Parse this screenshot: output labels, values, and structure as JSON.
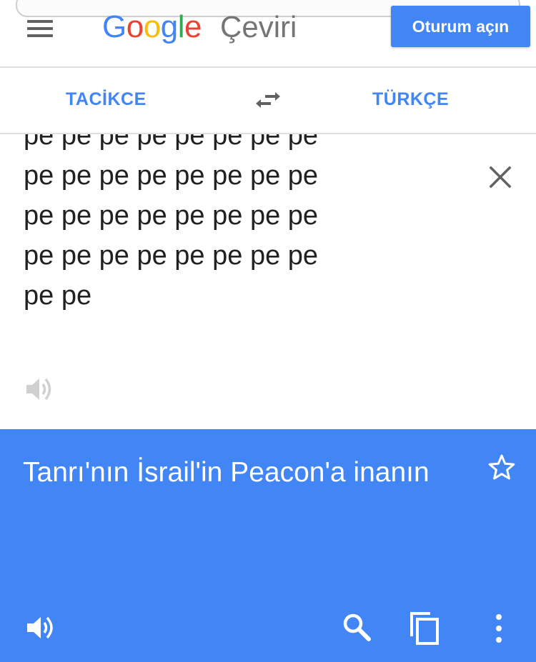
{
  "header": {
    "logo_letters": [
      {
        "char": "G",
        "color": "#4285f4"
      },
      {
        "char": "o",
        "color": "#ea4335"
      },
      {
        "char": "o",
        "color": "#fbbc05"
      },
      {
        "char": "g",
        "color": "#4285f4"
      },
      {
        "char": "l",
        "color": "#34a853"
      },
      {
        "char": "e",
        "color": "#ea4335"
      }
    ],
    "product_name": "Çeviri",
    "signin_label": "Oturum açın",
    "icons": {
      "menu": "menu-icon"
    }
  },
  "language_bar": {
    "source_language": "TACİKCE",
    "target_language": "TÜRKÇE",
    "swap_icon": "swap-arrows-icon"
  },
  "source": {
    "text": "pe pe pe pe pe pe pe pe\npe pe pe pe pe pe pe pe\npe pe pe pe pe pe pe pe\npe pe pe pe pe pe pe pe\npe pe",
    "icons": {
      "clear": "close-icon",
      "speak": "speaker-icon"
    }
  },
  "result": {
    "text": "Tanrı'nın İsrail'in Peacon'a inanın",
    "icons": {
      "star": "star-icon",
      "speak": "speaker-icon",
      "search": "search-icon",
      "copy": "copy-icon",
      "more": "more-vert-icon"
    }
  },
  "colors": {
    "accent": "#4285f4",
    "result_background": "#4285f4",
    "text_primary": "#212121",
    "icon_grey": "#616161",
    "divider": "#e0e0e0"
  }
}
